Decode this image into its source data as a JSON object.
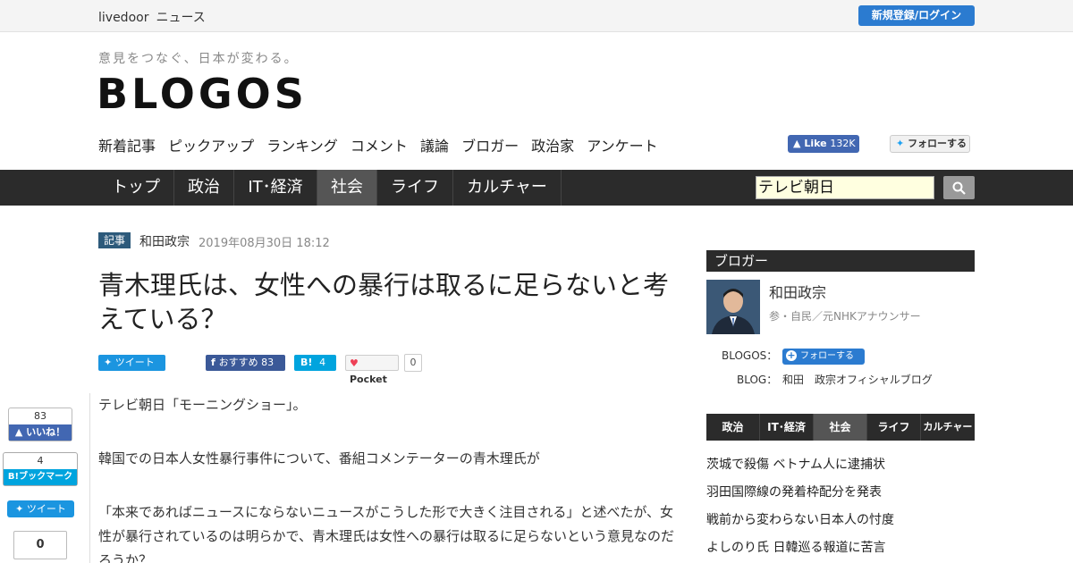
{
  "topbar": {
    "brand_1": "livedoor",
    "brand_2": "ニュース",
    "login": "新規登録/ログイン"
  },
  "header": {
    "tagline": "意見をつなぐ、日本が変わる。",
    "logo": "BLOGOS"
  },
  "subnav": [
    "新着記事",
    "ピックアップ",
    "ランキング",
    "コメント",
    "議論",
    "ブロガー",
    "政治家",
    "アンケート"
  ],
  "social": {
    "fb_like": "Like",
    "fb_count": "132K",
    "tw_follow": "フォローする"
  },
  "mainnav": [
    {
      "label": "トップ",
      "active": false
    },
    {
      "label": "政治",
      "active": false
    },
    {
      "label": "IT･経済",
      "active": false
    },
    {
      "label": "社会",
      "active": true
    },
    {
      "label": "ライフ",
      "active": false
    },
    {
      "label": "カルチャー",
      "active": false
    }
  ],
  "search": {
    "value": "テレビ朝日"
  },
  "article": {
    "tag": "記事",
    "author": "和田政宗",
    "date": "2019年08月30日 18:12",
    "title": "青木理氏は、女性への暴行は取るに足らないと考えている？",
    "share": {
      "tweet": "ツイート",
      "fb": "おすすめ",
      "fb_count": "83",
      "hb": "B!",
      "hb_count": "4",
      "pocket": "Pocket",
      "pocket_count": "0"
    },
    "paragraphs": [
      "テレビ朝日「モーニングショー」。",
      "韓国での日本人女性暴行事件について、番組コメンテーターの青木理氏が",
      "「本来であればニュースにならないニュースがこうした形で大きく注目される」と述べたが、女性が暴行されているのは明らかで、青木理氏は女性への暴行は取るに足らないという意見なのだろうか？"
    ]
  },
  "floating": {
    "like_count": "83",
    "like_label": "いいね！",
    "hb_count": "4",
    "hb_label": "B!ブックマーク",
    "tweet": "ツイート",
    "pocket_count": "0"
  },
  "sidebar": {
    "heading": "ブロガー",
    "name": "和田政宗",
    "role": "参・自民／元NHKアナウンサー",
    "blogos_label": "BLOGOS：",
    "follow": "フォローする",
    "blog_label": "BLOG：",
    "blog_name": "和田　政宗オフィシャルブログ",
    "tabs": [
      {
        "label": "政治",
        "active": false
      },
      {
        "label": "IT･経済",
        "active": false
      },
      {
        "label": "社会",
        "active": true
      },
      {
        "label": "ライフ",
        "active": false
      },
      {
        "label": "カルチャー",
        "active": false
      }
    ],
    "news": [
      "茨城で殺傷 ベトナム人に逮捕状",
      "羽田国際線の発着枠配分を発表",
      "戦前から変わらない日本人の忖度",
      "よしのり氏 日韓巡る報道に苦言"
    ]
  },
  "colors": {
    "accent": "#2b7bd0",
    "nav_bg": "#2b2b2b",
    "nav_active": "#555555"
  }
}
